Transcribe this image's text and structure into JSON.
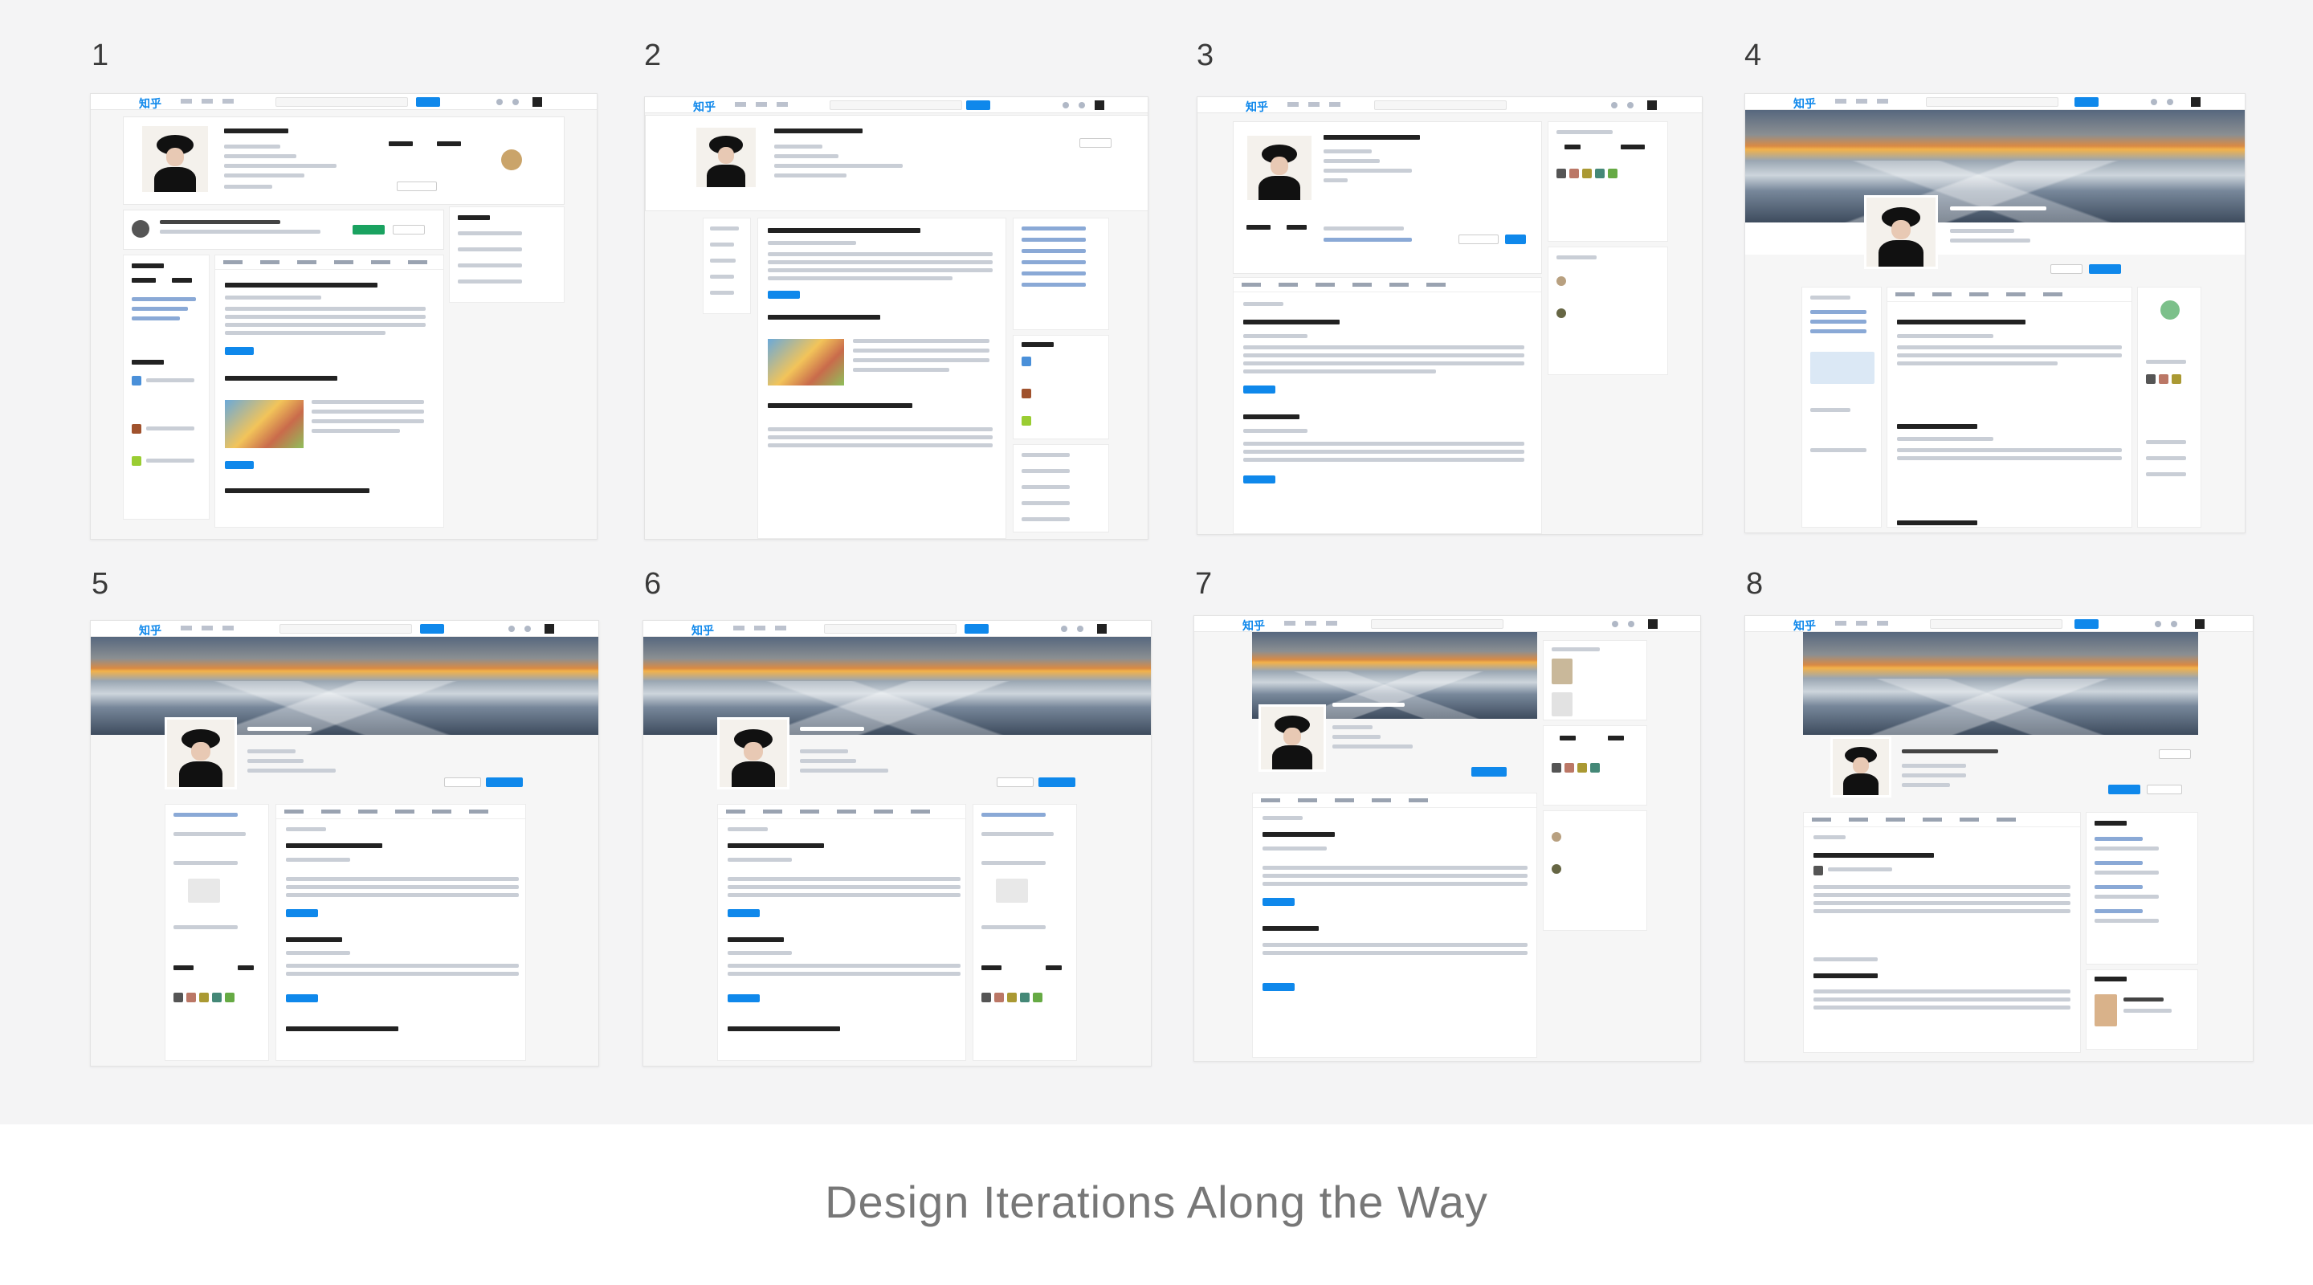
{
  "caption": "Design Iterations Along the Way",
  "iterations": [
    {
      "number": "1"
    },
    {
      "number": "2"
    },
    {
      "number": "3"
    },
    {
      "number": "4"
    },
    {
      "number": "5"
    },
    {
      "number": "6"
    },
    {
      "number": "7"
    },
    {
      "number": "8"
    }
  ],
  "mock": {
    "logo": "知乎",
    "colors": {
      "accent": "#0f88eb",
      "background": "#f4f4f5",
      "caption": "#777777"
    }
  }
}
